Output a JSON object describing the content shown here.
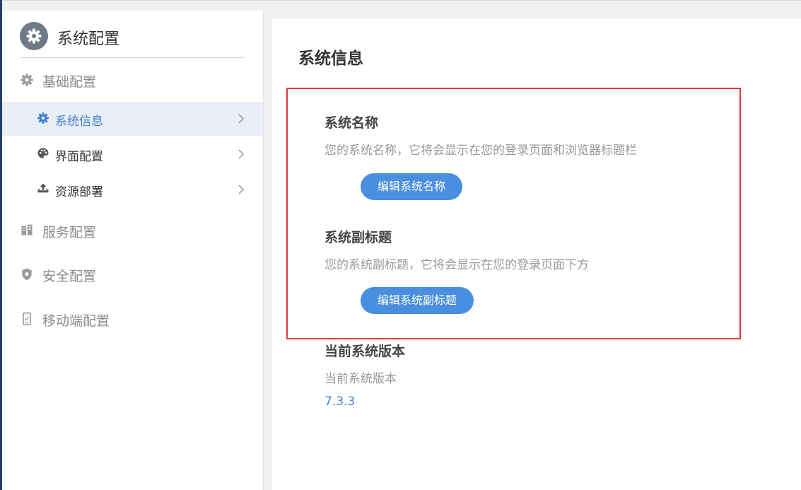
{
  "sidebar": {
    "title": "系统配置",
    "groups": [
      {
        "label": "基础配置",
        "icon": "gear-icon"
      },
      {
        "label": "服务配置",
        "icon": "server-icon"
      },
      {
        "label": "安全配置",
        "icon": "shield-icon"
      },
      {
        "label": "移动端配置",
        "icon": "mobile-icon"
      }
    ],
    "items": [
      {
        "label": "系统信息",
        "icon": "gear-icon",
        "active": true
      },
      {
        "label": "界面配置",
        "icon": "palette-icon"
      },
      {
        "label": "资源部署",
        "icon": "upload-icon"
      }
    ]
  },
  "main": {
    "title": "系统信息",
    "sections": [
      {
        "title": "系统名称",
        "desc": "您的系统名称，它将会显示在您的登录页面和浏览器标题栏",
        "button": "编辑系统名称"
      },
      {
        "title": "系统副标题",
        "desc": "您的系统副标题，它将会显示在您的登录页面下方",
        "button": "编辑系统副标题"
      },
      {
        "title": "当前系统版本",
        "desc": "当前系统版本",
        "value": "7.3.3"
      }
    ]
  },
  "colors": {
    "accent": "#4a8fdf",
    "active_text": "#3e7fd0",
    "highlight_border": "#e03a3e",
    "sidebar_active_bg": "#e9eef7"
  }
}
